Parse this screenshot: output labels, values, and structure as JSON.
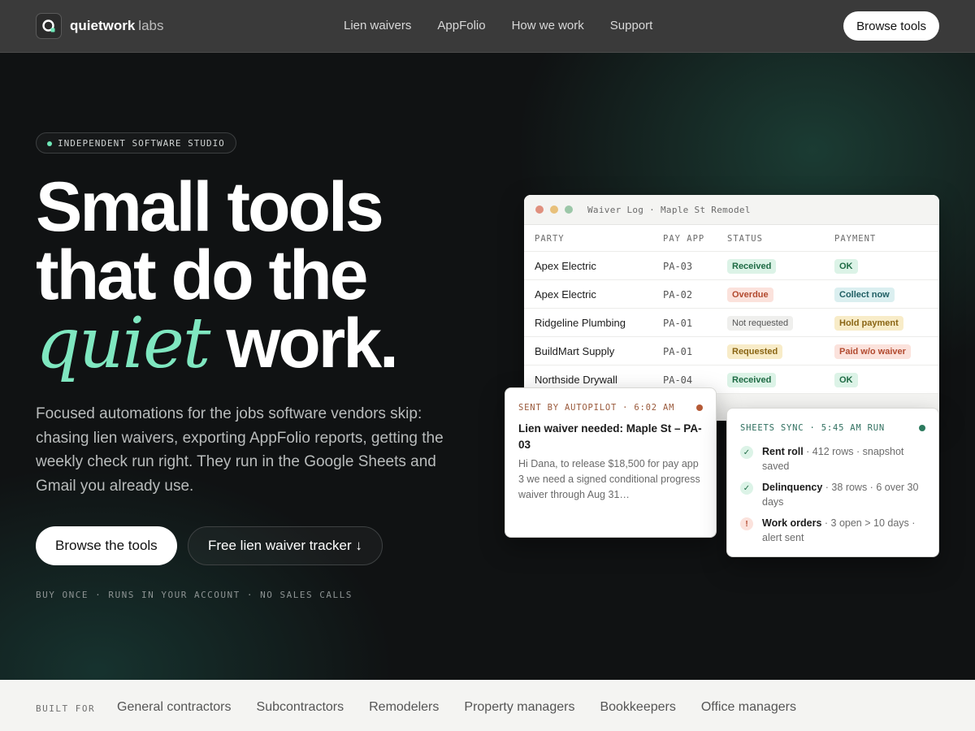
{
  "nav": {
    "brand": "quietwork",
    "brand_sub": "labs",
    "links": [
      "Lien waivers",
      "AppFolio",
      "How we work",
      "Support"
    ],
    "cta": "Browse tools"
  },
  "hero": {
    "pill": "INDEPENDENT SOFTWARE STUDIO",
    "headline_line1": "Small tools",
    "headline_line2": "that do the",
    "headline_accent": "quiet",
    "headline_end": "work.",
    "lede": "Focused automations for the jobs software vendors skip: chasing lien waivers, exporting AppFolio reports, getting the weekly check run right. They run in the Google Sheets and Gmail you already use.",
    "primary_cta": "Browse the tools",
    "secondary_cta": "Free lien waiver tracker ↓",
    "tagline": "BUY ONCE · RUNS IN YOUR ACCOUNT · NO SALES CALLS"
  },
  "waiver_log": {
    "title": "Waiver Log · Maple St Remodel",
    "headers": [
      "PARTY",
      "PAY APP",
      "STATUS",
      "PAYMENT"
    ],
    "rows": [
      {
        "party": "Apex Electric",
        "app": "PA-03",
        "status": "Received",
        "payment": "OK"
      },
      {
        "party": "Apex Electric",
        "app": "PA-02",
        "status": "Overdue",
        "payment": "Collect now"
      },
      {
        "party": "Ridgeline Plumbing",
        "app": "PA-01",
        "status": "Not requested",
        "payment": "Hold payment"
      },
      {
        "party": "BuildMart Supply",
        "app": "PA-01",
        "status": "Requested",
        "payment": "Paid w/o waiver"
      },
      {
        "party": "Northside Drywall",
        "app": "PA-04",
        "status": "Received",
        "payment": "OK"
      }
    ]
  },
  "email": {
    "tag": "SENT BY AUTOPILOT · 6:02 AM",
    "subject": "Lien waiver needed: Maple St – PA-03",
    "body": "Hi Dana, to release $18,500 for pay app 3 we need a signed conditional progress waiver through Aug 31…"
  },
  "sheets": {
    "tag": "SHEETS SYNC · 5:45 AM RUN",
    "items": [
      {
        "name": "Rent roll",
        "detail": " · 412 rows · snapshot saved",
        "icon": "check-icon"
      },
      {
        "name": "Delinquency",
        "detail": " · 38 rows · 6 over 30 days",
        "icon": "check-icon"
      },
      {
        "name": "Work orders",
        "detail": " · 3 open > 10 days · alert sent",
        "icon": "alert-icon"
      }
    ]
  },
  "built_for": {
    "label": "BUILT FOR",
    "items": [
      "General contractors",
      "Subcontractors",
      "Remodelers",
      "Property managers",
      "Bookkeepers",
      "Office managers"
    ]
  },
  "colors": {
    "accent": "#7fe7c0",
    "nav_bg": "#3a3a3a",
    "hero_bg": "#101213"
  }
}
